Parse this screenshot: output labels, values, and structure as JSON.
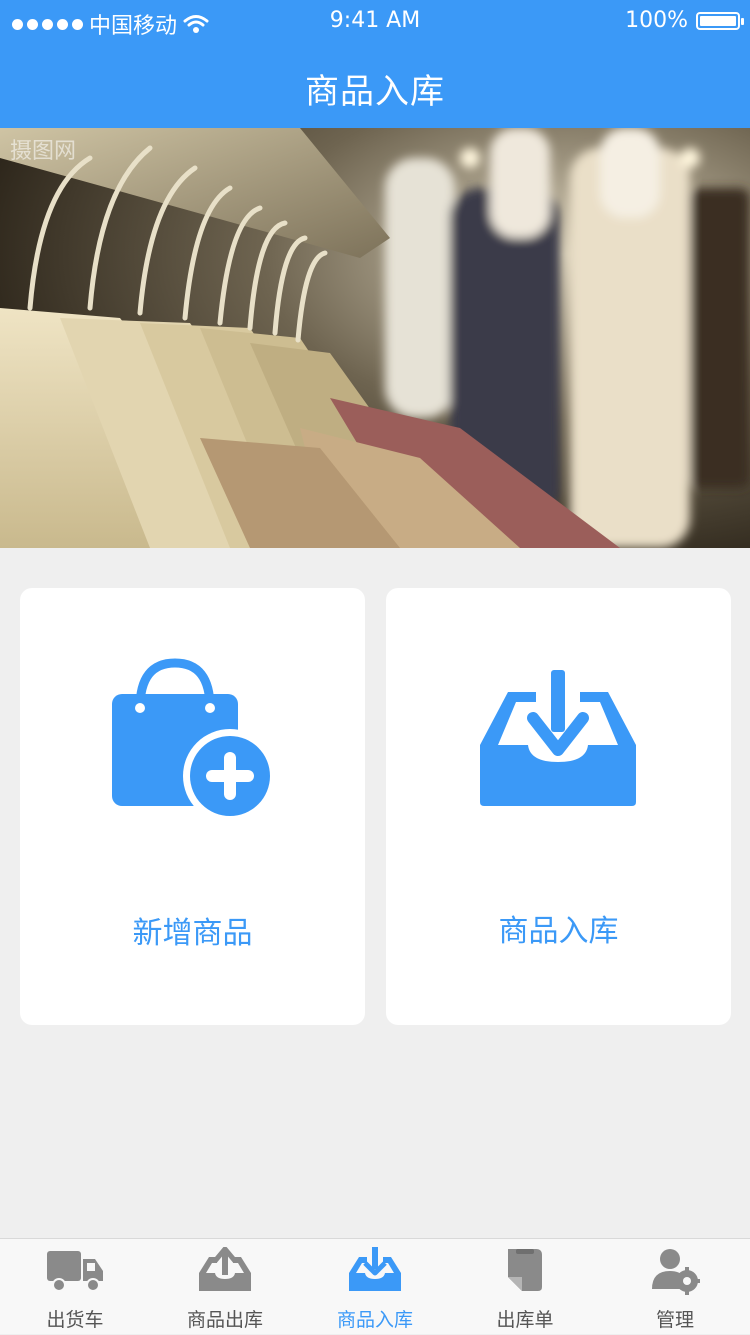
{
  "status_bar": {
    "carrier": "中国移动",
    "time": "9:41 AM",
    "battery": "100%",
    "battery_level": 1.0
  },
  "header": {
    "title": "商品入库"
  },
  "banner": {
    "watermark": "摄图网"
  },
  "cards": [
    {
      "label": "新增商品",
      "icon": "shopping-bag-plus-icon"
    },
    {
      "label": "商品入库",
      "icon": "inbox-download-icon"
    }
  ],
  "tabbar": {
    "items": [
      {
        "label": "出货车",
        "icon": "truck-icon",
        "active": false
      },
      {
        "label": "商品出库",
        "icon": "tray-upload-icon",
        "active": false
      },
      {
        "label": "商品入库",
        "icon": "tray-download-icon",
        "active": true
      },
      {
        "label": "出库单",
        "icon": "document-icon",
        "active": false
      },
      {
        "label": "管理",
        "icon": "user-gear-icon",
        "active": false
      }
    ]
  },
  "colors": {
    "primary": "#3b99f7",
    "inactive": "#8a8a8a",
    "background": "#efefef"
  }
}
